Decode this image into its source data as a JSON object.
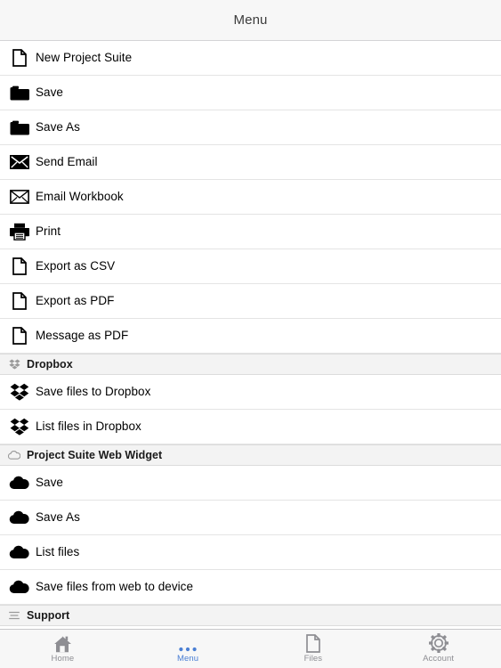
{
  "navbar": {
    "title": "Menu"
  },
  "list": [
    {
      "type": "row",
      "icon": "document-icon",
      "label": "New Project Suite"
    },
    {
      "type": "row",
      "icon": "folder-icon",
      "label": "Save"
    },
    {
      "type": "row",
      "icon": "folder-icon",
      "label": "Save As"
    },
    {
      "type": "row",
      "icon": "envelope-filled-icon",
      "label": "Send Email"
    },
    {
      "type": "row",
      "icon": "envelope-outline-icon",
      "label": "Email Workbook"
    },
    {
      "type": "row",
      "icon": "printer-icon",
      "label": "Print"
    },
    {
      "type": "row",
      "icon": "document-icon",
      "label": "Export as CSV"
    },
    {
      "type": "row",
      "icon": "document-icon",
      "label": "Export as PDF"
    },
    {
      "type": "row",
      "icon": "document-icon",
      "label": "Message as PDF"
    },
    {
      "type": "section",
      "icon": "dropbox-icon",
      "label": "Dropbox"
    },
    {
      "type": "row",
      "icon": "dropbox-icon",
      "label": "Save files to Dropbox"
    },
    {
      "type": "row",
      "icon": "dropbox-icon",
      "label": "List files in Dropbox"
    },
    {
      "type": "section",
      "icon": "cloud-outline-icon",
      "label": "Project Suite Web Widget"
    },
    {
      "type": "row",
      "icon": "cloud-filled-icon",
      "label": "Save"
    },
    {
      "type": "row",
      "icon": "cloud-filled-icon",
      "label": "Save As"
    },
    {
      "type": "row",
      "icon": "cloud-filled-icon",
      "label": "List files"
    },
    {
      "type": "row",
      "icon": "cloud-filled-icon",
      "label": "Save files from web to device"
    },
    {
      "type": "section",
      "icon": "list-lines-icon",
      "label": "Support"
    }
  ],
  "tabbar": {
    "tabs": [
      {
        "icon": "home-icon",
        "label": "Home",
        "active": false
      },
      {
        "icon": "ellipsis-icon",
        "label": "Menu",
        "active": true
      },
      {
        "icon": "file-icon",
        "label": "Files",
        "active": false
      },
      {
        "icon": "gear-icon",
        "label": "Account",
        "active": false
      }
    ]
  },
  "colors": {
    "accent": "#4a7fd4",
    "inactive": "#8e8e93",
    "section_bg": "#f3f3f3",
    "bar_bg": "#f7f7f7",
    "text": "#000000"
  }
}
